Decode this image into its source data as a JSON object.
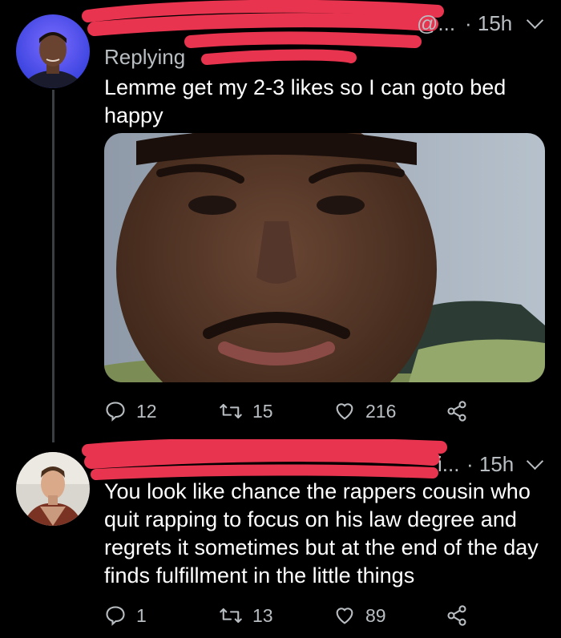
{
  "tweet1": {
    "handle_suffix": "@...",
    "time": "· 15h",
    "replying": "Replying",
    "text_line1": "Lemme get my 2-3 likes so I can goto bed",
    "text_line2": "happy",
    "reply_count": "12",
    "retweet_count": "15",
    "like_count": "216"
  },
  "tweet2": {
    "handle_suffix": "i...",
    "time": "· 15h",
    "text_lines": [
      "You look like chance the rappers cousin who",
      "quit rapping to focus on his law degree and",
      "regrets it sometimes but at the end of the day",
      "finds fulfillment in the little things"
    ],
    "reply_count": "1",
    "retweet_count": "13",
    "like_count": "89"
  },
  "colors": {
    "background": "#000000",
    "secondary_text": "#b9bec2",
    "redaction": "#e8344f",
    "thread_line": "#3a3f44"
  },
  "icons": [
    "reply-icon",
    "retweet-icon",
    "like-icon",
    "share-icon",
    "chevron-down-icon"
  ]
}
